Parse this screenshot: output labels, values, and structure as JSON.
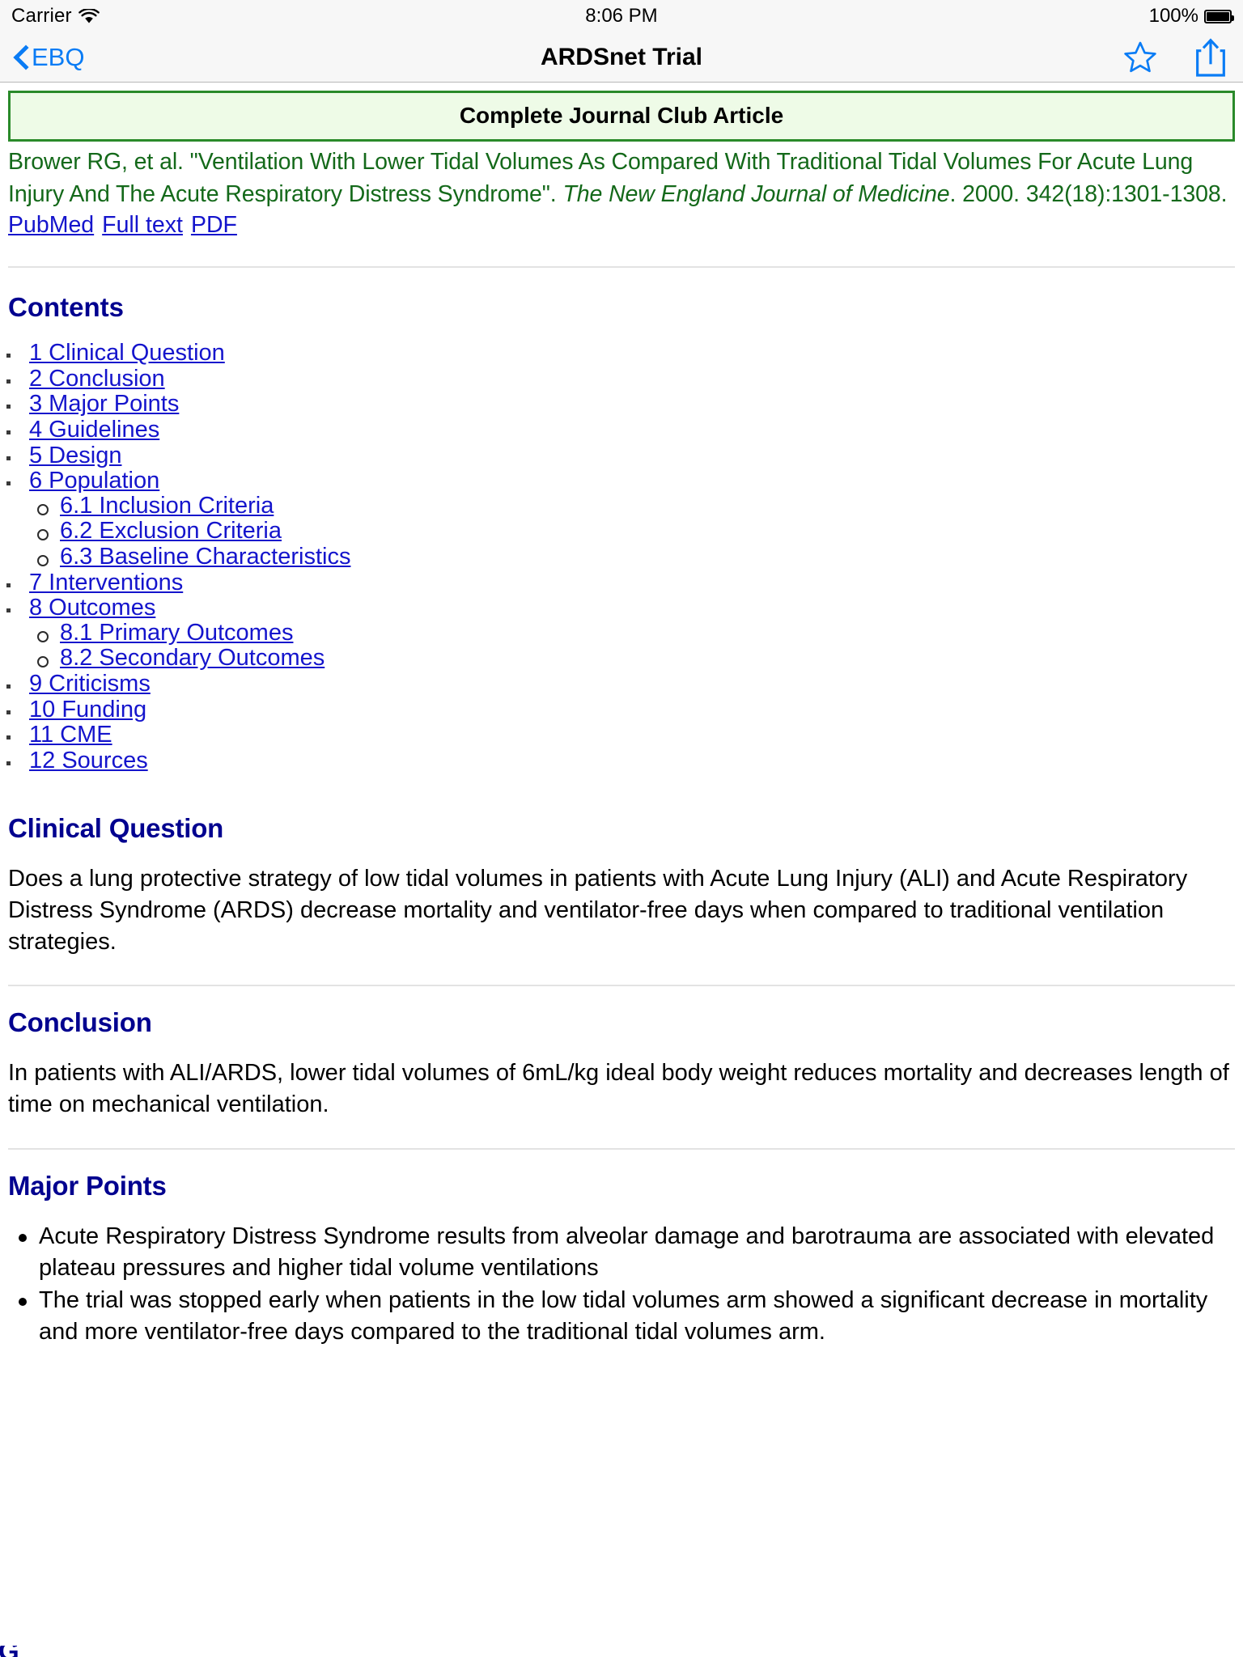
{
  "status_bar": {
    "carrier": "Carrier",
    "wifi_icon": "wifi-icon",
    "time": "8:06 PM",
    "battery_percent": "100%",
    "battery_icon": "battery-full-icon"
  },
  "nav_bar": {
    "back_label": "EBQ",
    "back_icon": "chevron-left-icon",
    "title": "ARDSnet Trial",
    "favorite_icon": "star-outline-icon",
    "share_icon": "share-upload-icon",
    "accent_color": "#0a7cf5"
  },
  "article": {
    "banner": {
      "label": "Complete Journal Club Article",
      "border_color": "#2a8a2a",
      "background_color": "#eefbe7"
    },
    "citation": {
      "color": "#14691a",
      "part1": "Brower RG, et al. \"Ventilation With Lower Tidal Volumes As Compared With Traditional Tidal Volumes For Acute Lung Injury And The Acute Respiratory Distress Syndrome\". ",
      "journal": "The New England Journal of Medicine",
      "part2": ". 2000. 342(18):1301-1308."
    },
    "citation_links": [
      {
        "label": "PubMed"
      },
      {
        "label": "Full text"
      },
      {
        "label": "PDF"
      }
    ],
    "contents_heading": "Contents",
    "link_color": "#1414cc",
    "heading_color": "#00008f",
    "toc": [
      {
        "label": "1 Clinical Question",
        "sub": []
      },
      {
        "label": "2 Conclusion",
        "sub": []
      },
      {
        "label": "3 Major Points",
        "sub": []
      },
      {
        "label": "4 Guidelines",
        "sub": []
      },
      {
        "label": "5 Design",
        "sub": []
      },
      {
        "label": "6 Population",
        "sub": [
          {
            "label": "6.1 Inclusion Criteria"
          },
          {
            "label": "6.2 Exclusion Criteria"
          },
          {
            "label": "6.3 Baseline Characteristics"
          }
        ]
      },
      {
        "label": "7 Interventions",
        "sub": []
      },
      {
        "label": "8 Outcomes",
        "sub": [
          {
            "label": "8.1 Primary Outcomes"
          },
          {
            "label": "8.2 Secondary Outcomes"
          }
        ]
      },
      {
        "label": "9 Criticisms",
        "sub": []
      },
      {
        "label": "10 Funding",
        "sub": []
      },
      {
        "label": "11 CME",
        "sub": []
      },
      {
        "label": "12 Sources",
        "sub": []
      }
    ],
    "sections": {
      "clinical_question": {
        "heading": "Clinical Question",
        "body": "Does a lung protective strategy of low tidal volumes in patients with Acute Lung Injury (ALI) and Acute Respiratory Distress Syndrome (ARDS) decrease mortality and ventilator-free days when compared to traditional ventilation strategies."
      },
      "conclusion": {
        "heading": "Conclusion",
        "body": "In patients with ALI/ARDS, lower tidal volumes of 6mL/kg ideal body weight reduces mortality and decreases length of time on mechanical ventilation."
      },
      "major_points": {
        "heading": "Major Points",
        "points": [
          "Acute Respiratory Distress Syndrome results from alveolar damage and barotrauma are associated with elevated plateau pressures and higher tidal volume ventilations",
          "The trial was stopped early when patients in the low tidal volumes arm showed a significant decrease in mortality and more ventilator-free days compared to the traditional tidal volumes arm."
        ]
      }
    }
  }
}
